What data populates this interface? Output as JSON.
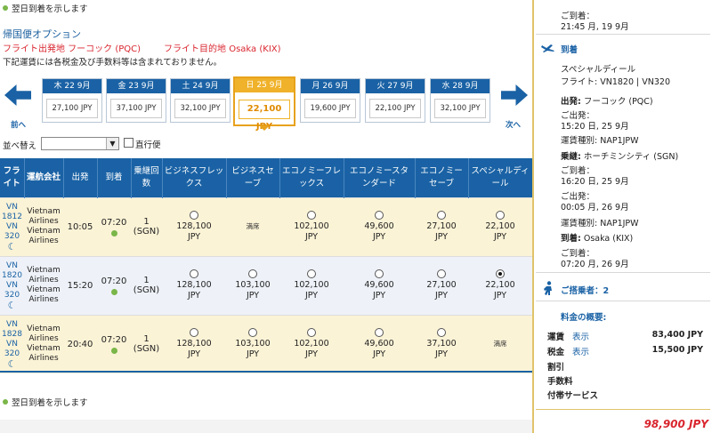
{
  "notes": {
    "top": "翌日到着を示します",
    "bottom": "翌日到着を示します"
  },
  "header": {
    "title": "帰国便オプション",
    "origin": "フライト出発地 フーコック (PQC)",
    "destination": "フライト目的地 Osaka (KIX)",
    "disclaimer": "下記運賃には各税金及び手数料等は含まれておりません。"
  },
  "date_strip": {
    "prev_label": "前へ",
    "next_label": "次へ",
    "dates": [
      {
        "label": "木 22 9月",
        "price": "27,100 JPY"
      },
      {
        "label": "金 23 9月",
        "price": "37,100 JPY"
      },
      {
        "label": "土 24 9月",
        "price": "32,100 JPY"
      },
      {
        "label": "日 25 9月",
        "price": "22,100 JPY"
      },
      {
        "label": "月 26 9月",
        "price": "19,600 JPY"
      },
      {
        "label": "火 27 9月",
        "price": "22,100 JPY"
      },
      {
        "label": "水 28 9月",
        "price": "32,100 JPY"
      }
    ]
  },
  "sort": {
    "label": "並べ替え",
    "selected": "",
    "direct_label": "直行便"
  },
  "table": {
    "headers": [
      "フライト",
      "運航会社",
      "出発",
      "到着",
      "乗継回数",
      "ビジネスフレックス",
      "ビジネスセーブ",
      "エコノミーフレックス",
      "エコノミースタンダード",
      "エコノミーセーブ",
      "スペシャルディール"
    ],
    "soldout_text": "満席",
    "rows": [
      {
        "flight1": "VN",
        "flight2": "1812",
        "flight3": "VN",
        "flight4": "320",
        "carrier": [
          "Vietnam",
          "Airlines",
          "Vietnam",
          "Airlines"
        ],
        "depart": "10:05",
        "arrive": "07:20",
        "stops": "1",
        "via": "(SGN)",
        "fares": [
          {
            "value": "128,100",
            "unit": "JPY",
            "soldout": false
          },
          {
            "value": "",
            "unit": "",
            "soldout": true
          },
          {
            "value": "102,100",
            "unit": "JPY",
            "soldout": false
          },
          {
            "value": "49,600",
            "unit": "JPY",
            "soldout": false
          },
          {
            "value": "27,100",
            "unit": "JPY",
            "soldout": false
          },
          {
            "value": "22,100",
            "unit": "JPY",
            "soldout": false
          }
        ]
      },
      {
        "flight1": "VN",
        "flight2": "1820",
        "flight3": "VN",
        "flight4": "320",
        "carrier": [
          "Vietnam",
          "Airlines",
          "Vietnam",
          "Airlines"
        ],
        "depart": "15:20",
        "arrive": "07:20",
        "stops": "1",
        "via": "(SGN)",
        "fares": [
          {
            "value": "128,100",
            "unit": "JPY",
            "soldout": false
          },
          {
            "value": "103,100",
            "unit": "JPY",
            "soldout": false
          },
          {
            "value": "102,100",
            "unit": "JPY",
            "soldout": false
          },
          {
            "value": "49,600",
            "unit": "JPY",
            "soldout": false
          },
          {
            "value": "27,100",
            "unit": "JPY",
            "soldout": false
          },
          {
            "value": "22,100",
            "unit": "JPY",
            "soldout": false,
            "selected": true
          }
        ]
      },
      {
        "flight1": "VN",
        "flight2": "1828",
        "flight3": "VN",
        "flight4": "320",
        "carrier": [
          "Vietnam",
          "Airlines",
          "Vietnam",
          "Airlines"
        ],
        "depart": "20:40",
        "arrive": "07:20",
        "stops": "1",
        "via": "(SGN)",
        "fares": [
          {
            "value": "128,100",
            "unit": "JPY",
            "soldout": false
          },
          {
            "value": "103,100",
            "unit": "JPY",
            "soldout": false
          },
          {
            "value": "102,100",
            "unit": "JPY",
            "soldout": false
          },
          {
            "value": "49,600",
            "unit": "JPY",
            "soldout": false
          },
          {
            "value": "37,100",
            "unit": "JPY",
            "soldout": false
          },
          {
            "value": "",
            "unit": "",
            "soldout": true
          }
        ]
      }
    ]
  },
  "panel": {
    "top_arrival_label": "ご到着：",
    "top_arrival_time": "21:45 月, 19 9月",
    "section_title": "到着",
    "fare_type": "スペシャルディール",
    "flight_label": "フライト:",
    "flight_value": "VN1820 | VN320",
    "depart_label": "出発:",
    "depart_value": "フーコック (PQC)",
    "dep_time_label": "ご出発：",
    "dep_time": "15:20 日, 25 9月",
    "fare_class_label": "運賃種別:",
    "fare_class": "NAP1JPW",
    "transit_label": "乗継:",
    "transit_value": "ホーチミンシティ (SGN)",
    "transit_arr_label": "ご到着：",
    "transit_arr": "16:20 日, 25 9月",
    "transit_dep_label": "ご出発：",
    "transit_dep": "00:05 月, 26 9月",
    "fare_class2_label": "運賃種別:",
    "fare_class2": "NAP1JPW",
    "arrival_label": "到着:",
    "arrival_value": "Osaka (KIX)",
    "final_arr_label": "ご到着：",
    "final_arr": "07:20 月, 26 9月",
    "passengers": "ご搭乗者：2",
    "summary_title": "料金の概要:",
    "fare_label": "運賃",
    "show_label": "表示",
    "fare_value": "83,400 JPY",
    "tax_label": "税金",
    "tax_value": "15,500 JPY",
    "discount_label": "割引",
    "fee_label": "手数料",
    "extras_label": "付帯サービス",
    "total": "98,900 JPY"
  },
  "colors": {
    "primary": "#1a62a5",
    "selected": "#e7a21d",
    "total": "#d9262f"
  }
}
